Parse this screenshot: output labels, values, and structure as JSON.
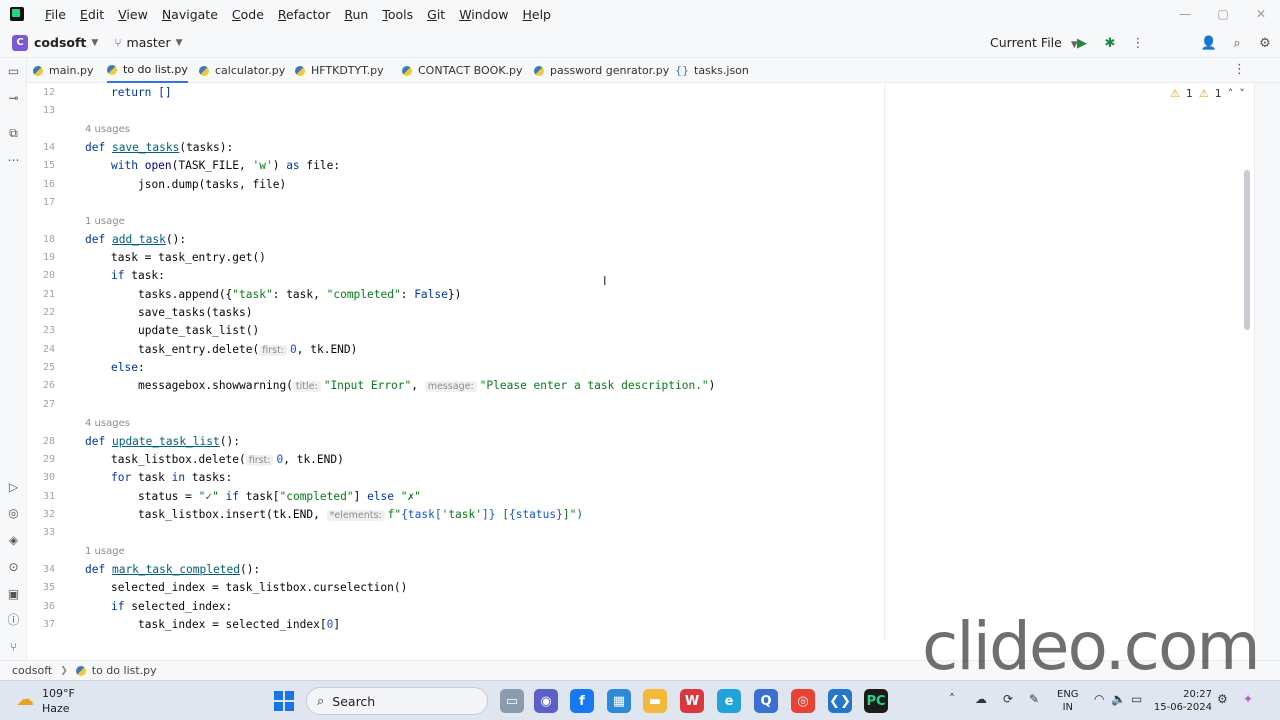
{
  "menu": {
    "items": [
      {
        "u": "F",
        "rest": "ile"
      },
      {
        "u": "E",
        "rest": "dit"
      },
      {
        "u": "V",
        "rest": "iew"
      },
      {
        "u": "N",
        "rest": "avigate"
      },
      {
        "u": "C",
        "rest": "ode"
      },
      {
        "u": "R",
        "rest": "efactor"
      },
      {
        "u": "R",
        "rest": "un"
      },
      {
        "u": "T",
        "rest": "ools"
      },
      {
        "u": "G",
        "rest": "it"
      },
      {
        "u": "W",
        "rest": "indow"
      },
      {
        "u": "H",
        "rest": "elp"
      }
    ]
  },
  "toolbar": {
    "project_badge": "C",
    "project_name": "codsoft",
    "branch": "master",
    "run_config": "Current File"
  },
  "tabs": [
    {
      "label": "main.py",
      "icon": "python-file-icon",
      "active": false
    },
    {
      "label": "to do list.py",
      "icon": "python-file-icon",
      "active": true
    },
    {
      "label": "calculator.py",
      "icon": "python-file-icon",
      "active": false
    },
    {
      "label": "HFTKDTYT.py",
      "icon": "python-file-icon",
      "active": false
    },
    {
      "label": "CONTACT BOOK.py",
      "icon": "python-file-icon",
      "active": false
    },
    {
      "label": "password genrator.py",
      "icon": "python-file-icon",
      "active": false
    },
    {
      "label": "tasks.json",
      "icon": "json-file-icon",
      "active": false
    }
  ],
  "editor": {
    "inspection": {
      "warnings": "1",
      "weak_warnings": "1"
    },
    "usages": {
      "save_tasks": "4 usages",
      "add_task": "1 usage",
      "update_task_list": "4 usages",
      "mark_task_completed": "1 usage"
    },
    "line_numbers": [
      "12",
      "13",
      "14",
      "15",
      "16",
      "17",
      "18",
      "19",
      "20",
      "21",
      "22",
      "23",
      "24",
      "25",
      "26",
      "27",
      "28",
      "29",
      "30",
      "31",
      "32",
      "33",
      "34",
      "35",
      "36",
      "37"
    ],
    "hints": {
      "first": "first:",
      "title": "title:",
      "message": "message:",
      "elements": "*elements:"
    },
    "code": {
      "l12": "return []",
      "l14_def": "def",
      "l14_name": "save_tasks",
      "l14_rest": "(tasks):",
      "l15_with": "with",
      "l15_open": "open",
      "l15_a": "(TASK_FILE, ",
      "l15_str": "'w'",
      "l15_b": ") ",
      "l15_as": "as",
      "l15_c": " file:",
      "l16": "json.dump(tasks, file)",
      "l18_def": "def",
      "l18_name": "add_task",
      "l18_rest": "():",
      "l19": "task = task_entry.get()",
      "l20_if": "if",
      "l20_rest": " task:",
      "l21_a": "tasks.append({",
      "l21_s1": "\"task\"",
      "l21_b": ": task, ",
      "l21_s2": "\"completed\"",
      "l21_c": ": ",
      "l21_false": "False",
      "l21_d": "})",
      "l22": "save_tasks(tasks)",
      "l23": "update_task_list()",
      "l24_a": "task_entry.delete(",
      "l24_num": "0",
      "l24_b": ", tk.END)",
      "l25_else": "else",
      "l25_rest": ":",
      "l26_a": "messagebox.showwarning(",
      "l26_s1": "\"Input Error\"",
      "l26_b": ", ",
      "l26_s2": "\"Please enter a task description.\"",
      "l26_c": ")",
      "l28_def": "def",
      "l28_name": "update_task_list",
      "l28_rest": "():",
      "l29_a": "task_listbox.delete(",
      "l29_num": "0",
      "l29_b": ", tk.END)",
      "l30_for": "for",
      "l30_a": " task ",
      "l30_in": "in",
      "l30_b": " tasks:",
      "l31_a": "status = ",
      "l31_s1": "\"✓\"",
      "l31_if": " if ",
      "l31_b": "task[",
      "l31_s2": "\"completed\"",
      "l31_c": "] ",
      "l31_else": "else",
      "l31_d": " ",
      "l31_s3": "\"✗\"",
      "l32_a": "task_listbox.insert(tk.END, ",
      "l32_f": "f\"",
      "l32_b": "{task[",
      "l32_s": "'task'",
      "l32_c": "]}",
      "l32_d": " [",
      "l32_e": "{status}",
      "l32_g": "]\")",
      "l34_def": "def",
      "l34_name": "mark_task_completed",
      "l34_rest": "():",
      "l35": "selected_index = task_listbox.curselection()",
      "l36_if": "if",
      "l36_rest": " selected_index:",
      "l37_a": "task_index = selected_index[",
      "l37_num": "0",
      "l37_b": "]"
    }
  },
  "statusbar": {
    "project": "codsoft",
    "file": "to do list.py"
  },
  "watermark": "clideo.com",
  "taskbar": {
    "weather_temp": "109°F",
    "weather_desc": "Haze",
    "search_label": "Search",
    "lang_top": "ENG",
    "lang_bottom": "IN",
    "time": "20:27",
    "date": "15-06-2024"
  }
}
